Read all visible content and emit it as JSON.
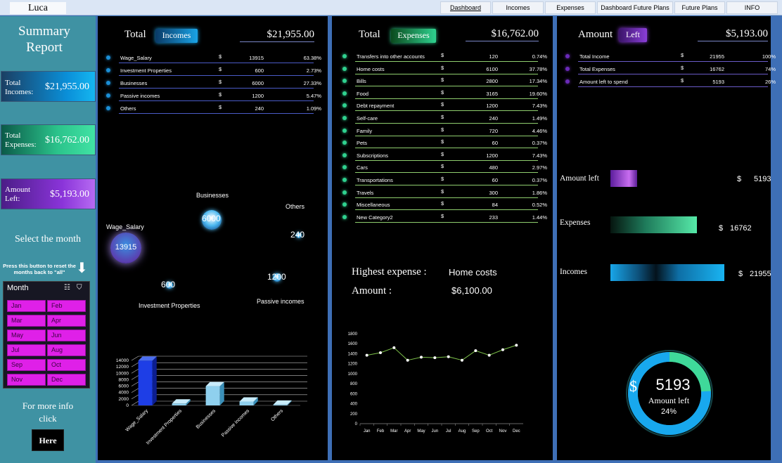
{
  "topbar": {
    "user": "Luca",
    "tabs": [
      "Dashboard",
      "Incomes",
      "Expenses",
      "Dashboard Future Plans",
      "Future Plans",
      "INFO"
    ]
  },
  "sidebar": {
    "title_line1": "Summary",
    "title_line2": "Report",
    "kpis": [
      {
        "label1": "Total",
        "label2": "Incomes:",
        "value": "$21,955.00"
      },
      {
        "label1": "Total",
        "label2": "Expenses:",
        "value": "$16,762.00"
      },
      {
        "label1": "Amount",
        "label2": "Left:",
        "value": "$5,193.00"
      }
    ],
    "select_month": "Select the month",
    "reset_note": "Press this button to reset the months back to \"all\"",
    "slicer_header": "Month",
    "months": [
      "Jan",
      "Feb",
      "Mar",
      "Apr",
      "May",
      "Jun",
      "Jul",
      "Aug",
      "Sep",
      "Oct",
      "Nov",
      "Dec"
    ],
    "more_info_line1": "For more info",
    "more_info_line2": "click",
    "here_button": "Here"
  },
  "incomes": {
    "title": "Total",
    "badge": "Incomes",
    "total": "$21,955.00",
    "currency": "$",
    "rows": [
      {
        "name": "Wage_Salary",
        "value": "13915",
        "pct": "63.38%"
      },
      {
        "name": "Investment Properties",
        "value": "600",
        "pct": "2.73%"
      },
      {
        "name": "Businesses",
        "value": "6000",
        "pct": "27.33%"
      },
      {
        "name": "Passive incomes",
        "value": "1200",
        "pct": "5.47%"
      },
      {
        "name": "Others",
        "value": "240",
        "pct": "1.09%"
      }
    ],
    "bubbles": [
      {
        "name": "Wage_Salary",
        "value": "13915"
      },
      {
        "name": "Investment Properties",
        "value": "600"
      },
      {
        "name": "Businesses",
        "value": "6000"
      },
      {
        "name": "Passive incomes",
        "value": "1200"
      },
      {
        "name": "Others",
        "value": "240"
      }
    ]
  },
  "expenses": {
    "title": "Total",
    "badge": "Expenses",
    "total": "$16,762.00",
    "currency": "$",
    "rows": [
      {
        "name": "Transfers into other accounts",
        "value": "120",
        "pct": "0.74%"
      },
      {
        "name": "Home costs",
        "value": "6100",
        "pct": "37.78%"
      },
      {
        "name": "Bills",
        "value": "2800",
        "pct": "17.34%"
      },
      {
        "name": "Food",
        "value": "3165",
        "pct": "19.60%"
      },
      {
        "name": "Debt repayment",
        "value": "1200",
        "pct": "7.43%"
      },
      {
        "name": "Self-care",
        "value": "240",
        "pct": "1.49%"
      },
      {
        "name": "Family",
        "value": "720",
        "pct": "4.46%"
      },
      {
        "name": "Pets",
        "value": "60",
        "pct": "0.37%"
      },
      {
        "name": "Subscriptions",
        "value": "1200",
        "pct": "7.43%"
      },
      {
        "name": "Cars",
        "value": "480",
        "pct": "2.97%"
      },
      {
        "name": "Transportations",
        "value": "60",
        "pct": "0.37%"
      },
      {
        "name": "Travels",
        "value": "300",
        "pct": "1.86%"
      },
      {
        "name": "Miscellaneous",
        "value": "84",
        "pct": "0.52%"
      },
      {
        "name": "New Category2",
        "value": "233",
        "pct": "1.44%"
      }
    ],
    "highest_label": "Highest expense :",
    "highest_value": "Home costs",
    "amount_label": "Amount :",
    "amount_value": "$6,100.00"
  },
  "left": {
    "title": "Amount",
    "badge": "Left",
    "total": "$5,193.00",
    "currency": "$",
    "rows": [
      {
        "name": "Total Income",
        "value": "21955",
        "pct": "100%"
      },
      {
        "name": "Total Expenses",
        "value": "16762",
        "pct": "74%"
      },
      {
        "name": "Amount left to spend",
        "value": "5193",
        "pct": "26%"
      }
    ],
    "compare": [
      {
        "label": "Amount left",
        "value": "5193"
      },
      {
        "label": "Expenses",
        "value": "16762"
      },
      {
        "label": "Incomes",
        "value": "21955"
      }
    ],
    "donut_value": "5193",
    "donut_label": "Amount left",
    "donut_pct": "24%",
    "donut_fraction": 0.24,
    "donut_currency": "$"
  },
  "colors": {
    "income_accent": "#1aa3e6",
    "expense_accent": "#2fd18f",
    "left_accent": "#8a3ed8",
    "month_button": "#df20e8"
  },
  "chart_data": [
    {
      "type": "bar",
      "categories": [
        "Wage_Salary",
        "Investment Properties",
        "Businesses",
        "Passive incomes",
        "Others"
      ],
      "values": [
        13915,
        600,
        6000,
        1200,
        240
      ],
      "ylim": [
        0,
        14000
      ],
      "yticks": [
        0,
        2000,
        4000,
        6000,
        8000,
        10000,
        12000,
        14000
      ],
      "grid": true
    },
    {
      "type": "line",
      "categories": [
        "Jan",
        "Feb",
        "Mar",
        "Apr",
        "May",
        "Jun",
        "Jul",
        "Aug",
        "Sep",
        "Oct",
        "Nov",
        "Dec"
      ],
      "values": [
        1370,
        1420,
        1520,
        1270,
        1330,
        1320,
        1340,
        1270,
        1460,
        1370,
        1480,
        1570
      ],
      "ylim": [
        0,
        1800
      ],
      "yticks": [
        0,
        200,
        400,
        600,
        800,
        1000,
        1200,
        1400,
        1600,
        1800
      ],
      "grid": false
    }
  ]
}
